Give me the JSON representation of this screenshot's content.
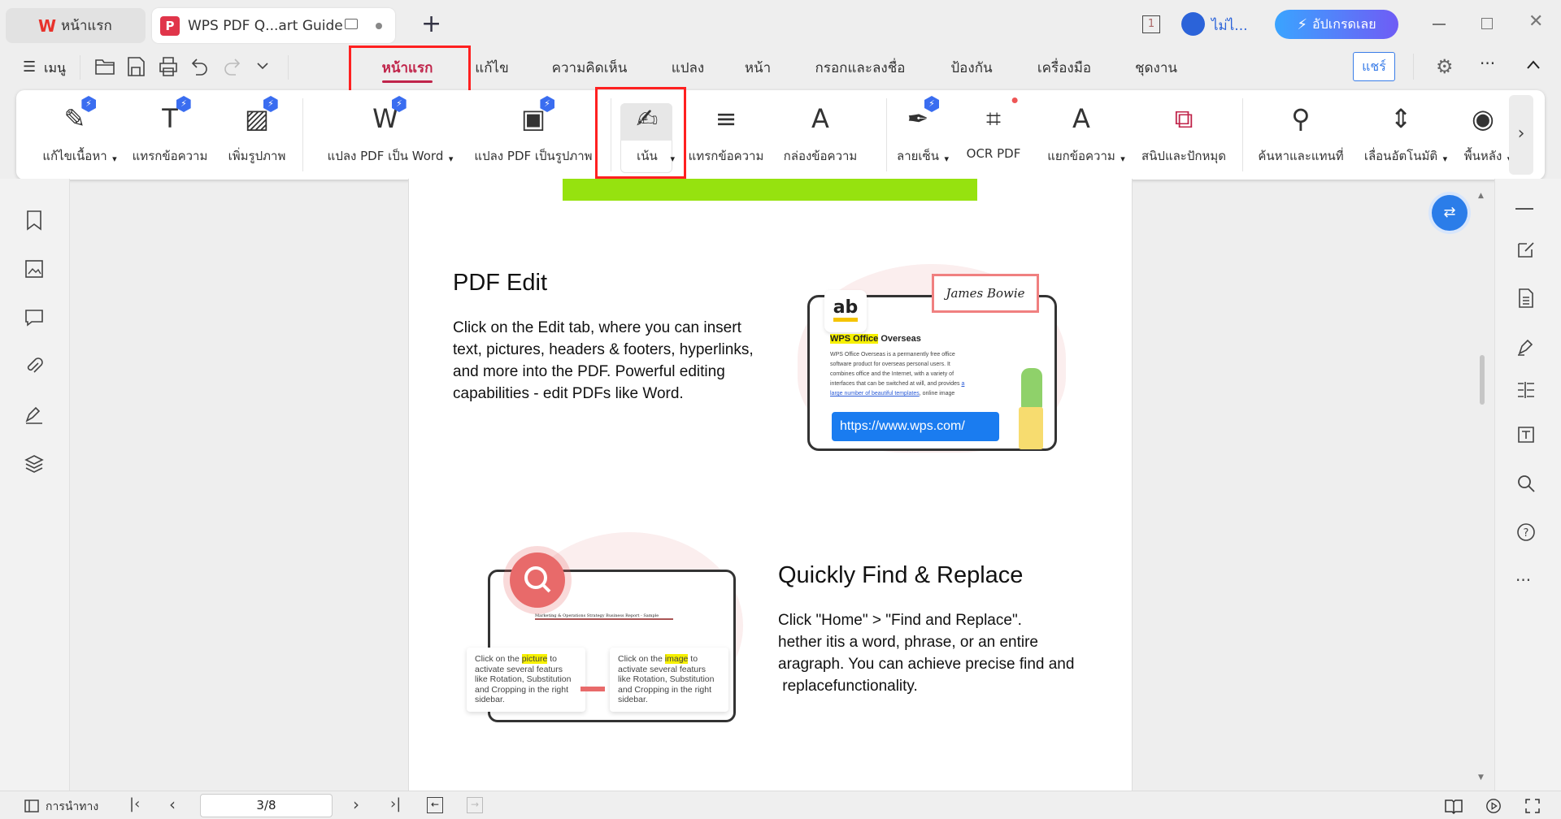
{
  "tabs": {
    "home_label": "หน้าแรก",
    "doc_label": "WPS PDF Q...art Guide",
    "new_tab": "+"
  },
  "titlebar": {
    "page_count_icon": "1",
    "user_label": "ไม่ไ...",
    "upgrade_label": "อัปเกรดเลย"
  },
  "menubar": {
    "menu_label": "เมนู",
    "tabs": [
      "หน้าแรก",
      "แก้ไข",
      "ความคิดเห็น",
      "แปลง",
      "หน้า",
      "กรอกและลงชื่อ",
      "ป้องกัน",
      "เครื่องมือ",
      "ชุดงาน"
    ],
    "active_tab": "หน้าแรก",
    "share_label": "แชร์"
  },
  "ribbon": {
    "items": [
      {
        "label": "แก้ไขเนื้อหา",
        "icon": "edit-content-icon",
        "dropdown": true
      },
      {
        "label": "แทรกข้อความ",
        "icon": "insert-text-icon"
      },
      {
        "label": "เพิ่มรูปภาพ",
        "icon": "add-image-icon"
      },
      {
        "label": "แปลง PDF เป็น Word",
        "icon": "pdf-to-word-icon",
        "dropdown": true
      },
      {
        "label": "แปลง PDF เป็นรูปภาพ",
        "icon": "pdf-to-image-icon"
      },
      {
        "label": "เน้น",
        "icon": "highlight-icon",
        "dropdown": true
      },
      {
        "label": "แทรกข้อความ",
        "icon": "text-comment-icon"
      },
      {
        "label": "กล่องข้อความ",
        "icon": "text-box-icon"
      },
      {
        "label": "ลายเซ็น",
        "icon": "signature-icon",
        "dropdown": true
      },
      {
        "label": "OCR PDF",
        "icon": "ocr-icon"
      },
      {
        "label": "แยกข้อความ",
        "icon": "extract-text-icon",
        "dropdown": true
      },
      {
        "label": "สนิปและปักหมุด",
        "icon": "snip-pin-icon"
      },
      {
        "label": "ค้นหาและแทนที่",
        "icon": "search-icon"
      },
      {
        "label": "เลื่อนอัตโนมัติ",
        "icon": "auto-scroll-icon",
        "dropdown": true
      },
      {
        "label": "พื้นหลัง",
        "icon": "background-icon",
        "dropdown": true
      }
    ]
  },
  "document": {
    "section1": {
      "title": "PDF Edit",
      "body": "Click on the Edit tab, where you can insert text, pictures, headers & footers, hyperlinks, and more into the PDF. Powerful editing capabilities - edit PDFs like Word.",
      "illustration": {
        "ab": "ab",
        "signature": "James Bowie",
        "doc_title_highlight": "WPS Office",
        "doc_title_rest": " Overseas",
        "doc_text": "WPS Office Overseas is a permanently free office software product for overseas personal users. It combines office and the Internet, with a variety of interfaces that can be switched at will, and provides",
        "doc_link": "a large number of beautiful templates",
        "doc_text2": ", online image",
        "url": "https://www.wps.com/"
      }
    },
    "section2": {
      "title": "Quickly Find & Replace",
      "body_lines": [
        "Click \"Home\" > \"Find and Replace\".",
        "hether itis a word, phrase, or an entire",
        "aragraph. You can achieve precise find and",
        " replacefunctionality."
      ],
      "illustration": {
        "doc_heading": "Marketing & Operations Strategy Business Report - Sample",
        "callout1": {
          "pre": "Click on the ",
          "hl": "picture",
          "post": " to activate several featurs like Rotation, Substitution and Cropping in the right sidebar."
        },
        "callout2": {
          "pre": "Click on the ",
          "hl": "image",
          "post": " to activate several featurs like Rotation, Substitution and Cropping in the right sidebar."
        }
      }
    }
  },
  "statusbar": {
    "nav_label": "การนำทาง",
    "page_value": "3/8"
  },
  "colors": {
    "accent": "#c0244a",
    "highlight_box": "#ff2020",
    "green_bar": "#96e20f",
    "blue": "#1a73e8"
  }
}
